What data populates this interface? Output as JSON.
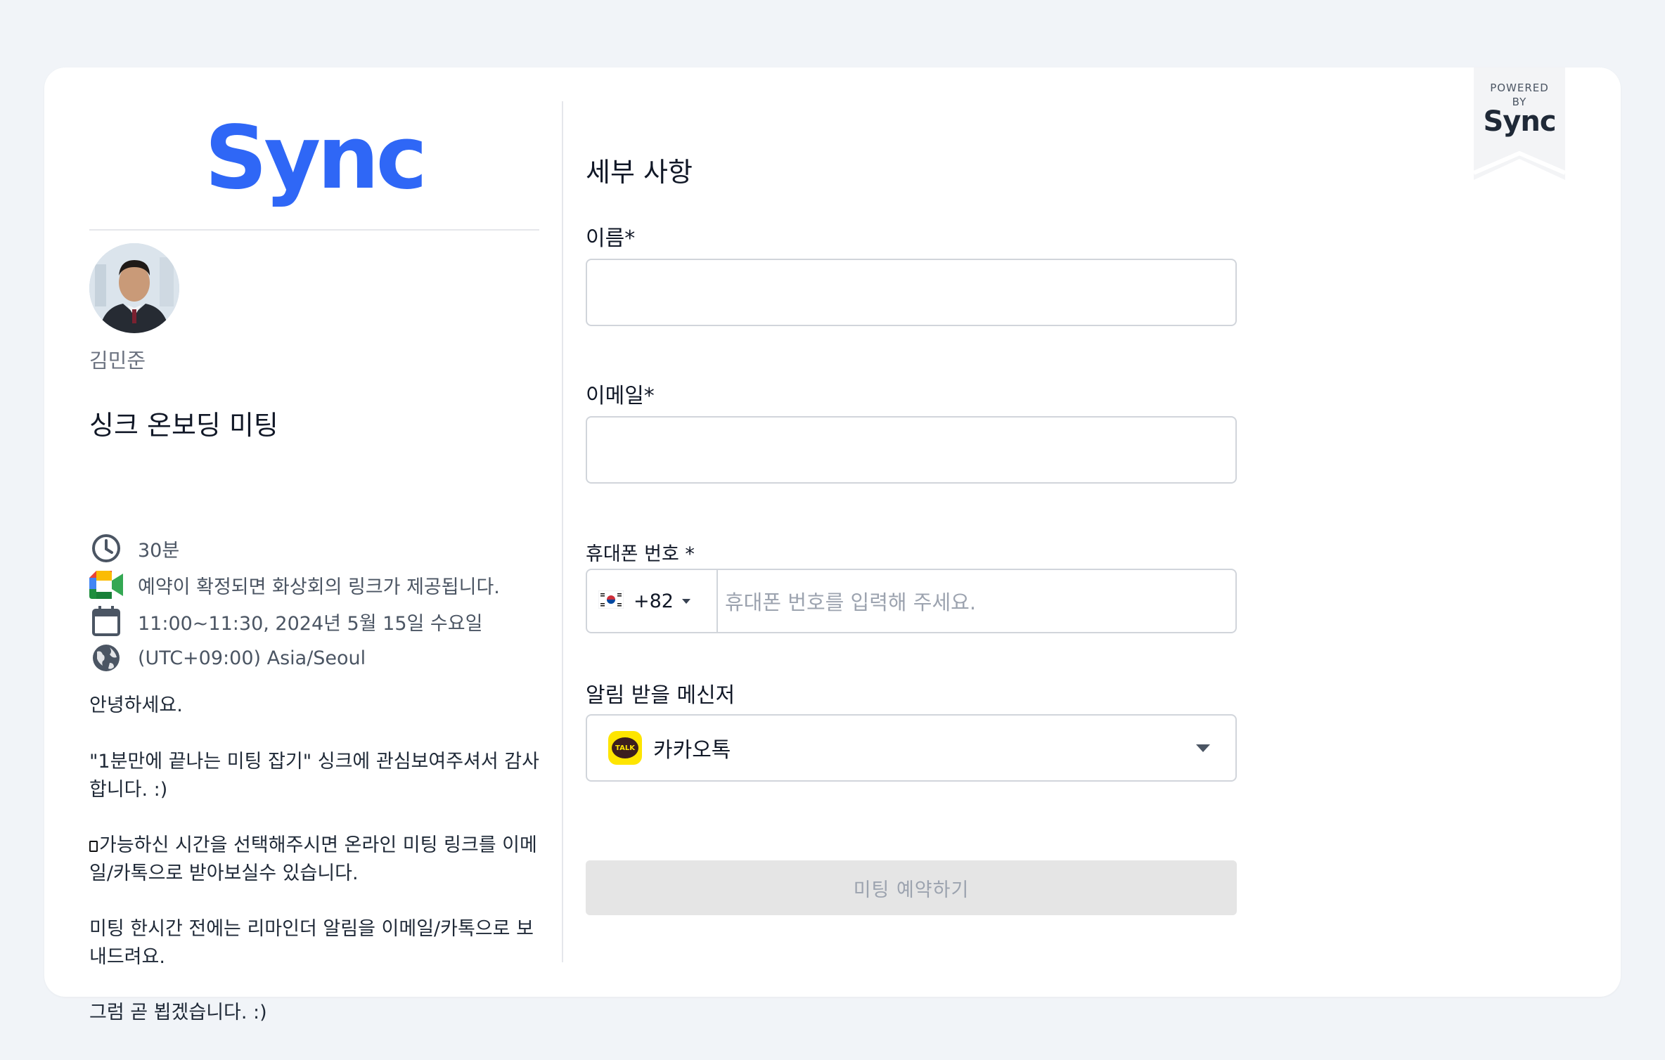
{
  "brand": {
    "logo_text": "Sync",
    "color": "#2f67f6"
  },
  "badge": {
    "powered": "POWERED",
    "by": "BY",
    "logo_text": "Sync"
  },
  "host": {
    "name": "김민준",
    "avatar_icon": "person-photo"
  },
  "event": {
    "title": "싱크 온보딩 미팅",
    "duration": "30분",
    "video_note": "예약이 확정되면 화상회의 링크가 제공됩니다.",
    "datetime": "11:00~11:30, 2024년 5월 15일 수요일",
    "timezone": "(UTC+09:00) Asia/Seoul"
  },
  "description": {
    "p1": "안녕하세요.",
    "p2": "\"1분만에 끝나는 미팅 잡기\" 싱크에 관심보여주셔서 감사합니다. :)",
    "p3": "가능하신 시간을 선택해주시면 온라인 미팅 링크를 이메일/카톡으로 받아보실수 있습니다.",
    "p4": "미팅 한시간 전에는 리마인더 알림을 이메일/카톡으로 보내드려요.",
    "p5": "그럼 곧 뵙겠습니다. :)"
  },
  "form": {
    "section_title": "세부 사항",
    "name_label": "이름*",
    "name_value": "",
    "email_label": "이메일*",
    "email_value": "",
    "phone_label": "휴대폰 번호 *",
    "phone_country_code": "+82",
    "phone_country_flag": "south-korea-flag",
    "phone_placeholder": "휴대폰 번호를 입력해 주세요.",
    "messenger_label": "알림 받을 메신저",
    "messenger_selected": "카카오톡",
    "messenger_icon_text": "TALK",
    "submit_label": "미팅 예약하기"
  }
}
